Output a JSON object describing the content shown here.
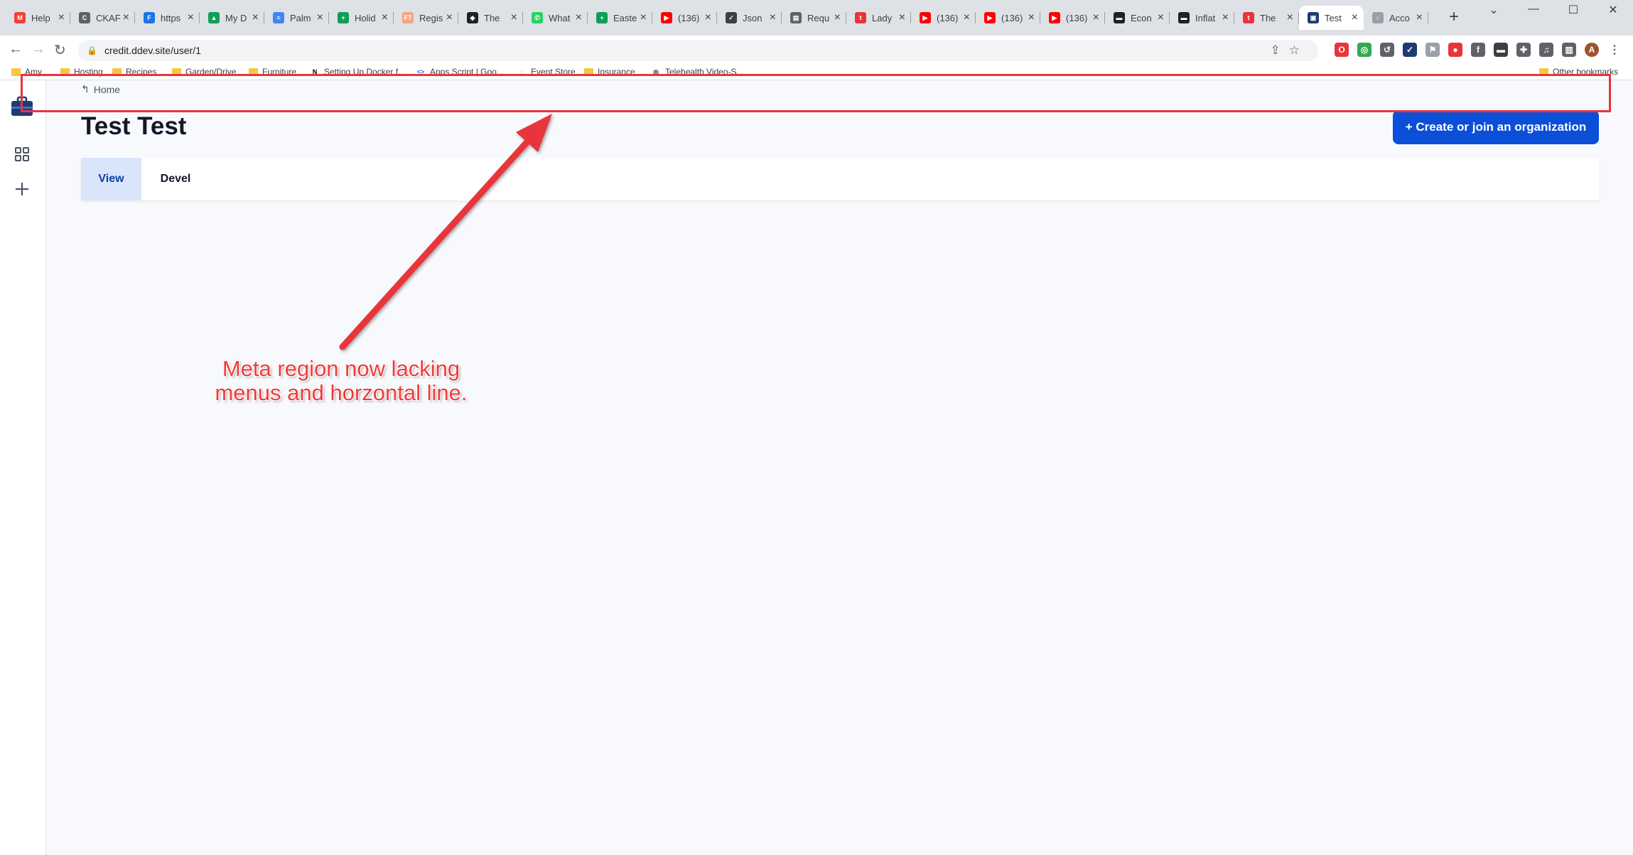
{
  "browser": {
    "tabs": [
      {
        "title": "Help",
        "fav": "M",
        "color": "#ea4335"
      },
      {
        "title": "CKAF",
        "fav": "C",
        "color": "#5f6368"
      },
      {
        "title": "https",
        "fav": "F",
        "color": "#1a73e8"
      },
      {
        "title": "My D",
        "fav": "▲",
        "color": "#0f9d58"
      },
      {
        "title": "Palm",
        "fav": "≡",
        "color": "#4285f4"
      },
      {
        "title": "Holid",
        "fav": "+",
        "color": "#0f9d58"
      },
      {
        "title": "Regis",
        "fav": "FT",
        "color": "#f4a582"
      },
      {
        "title": "The",
        "fav": "◆",
        "color": "#202124"
      },
      {
        "title": "What",
        "fav": "✆",
        "color": "#25d366"
      },
      {
        "title": "Easte",
        "fav": "+",
        "color": "#0f9d58"
      },
      {
        "title": "(136)",
        "fav": "▶",
        "color": "#ff0000"
      },
      {
        "title": "Json",
        "fav": "✓",
        "color": "#3c4043"
      },
      {
        "title": "Requ",
        "fav": "▤",
        "color": "#5f6368"
      },
      {
        "title": "Lady",
        "fav": "t",
        "color": "#e8353b"
      },
      {
        "title": "(136)",
        "fav": "▶",
        "color": "#ff0000"
      },
      {
        "title": "(136)",
        "fav": "▶",
        "color": "#ff0000"
      },
      {
        "title": "(136)",
        "fav": "▶",
        "color": "#ff0000"
      },
      {
        "title": "Econ",
        "fav": "▬",
        "color": "#202124"
      },
      {
        "title": "Inflat",
        "fav": "▬",
        "color": "#202124"
      },
      {
        "title": "The",
        "fav": "t",
        "color": "#e8353b"
      },
      {
        "title": "Test",
        "fav": "▣",
        "color": "#1f3b70",
        "active": true
      },
      {
        "title": "Acco",
        "fav": "○",
        "color": "#9aa0a6"
      }
    ],
    "url": "credit.ddev.site/user/1",
    "bookmarks": [
      {
        "label": "Amy",
        "type": "folder"
      },
      {
        "label": "Hosting",
        "type": "folder"
      },
      {
        "label": "Recipes",
        "type": "folder"
      },
      {
        "label": "Garden/Drive",
        "type": "folder"
      },
      {
        "label": "Furniture",
        "type": "folder"
      },
      {
        "label": "Setting Up Docker f...",
        "type": "site",
        "fav": "N",
        "color": "#000000"
      },
      {
        "label": "Apps Script | Goo...",
        "type": "site",
        "fav": "<>",
        "color": "#1a73e8"
      },
      {
        "label": "Event Store",
        "type": "site",
        "fav": "◌",
        "color": "#5cb85c"
      },
      {
        "label": "Insurance",
        "type": "folder"
      },
      {
        "label": "Telehealth Video-S...",
        "type": "site",
        "fav": "◍",
        "color": "#5f6368"
      }
    ],
    "other_bookmarks": "Other bookmarks"
  },
  "page": {
    "breadcrumb": "Home",
    "title": "Test Test",
    "cta_label": "+ Create or join an organization",
    "tabs": [
      "View",
      "Devel"
    ]
  },
  "annotation": {
    "line1": "Meta region now lacking",
    "line2": "menus and horzontal line."
  },
  "colors": {
    "accent": "#0b4fd9",
    "annotation": "#e8353b",
    "active_tab_bg": "#d9e5fb"
  }
}
